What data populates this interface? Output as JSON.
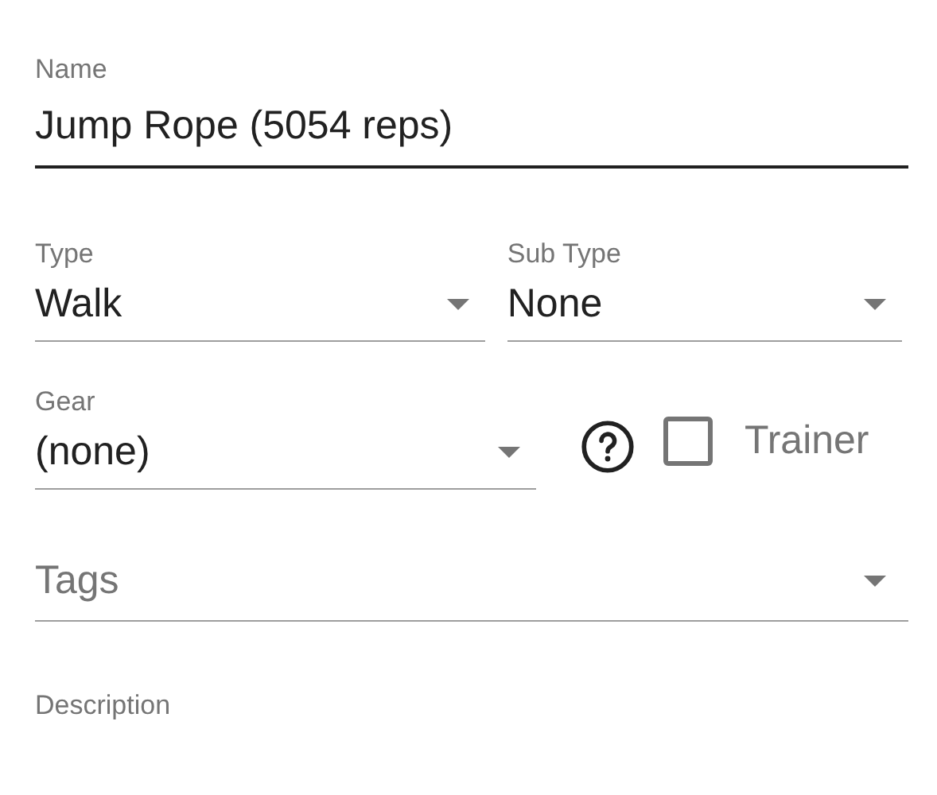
{
  "name_field": {
    "label": "Name",
    "value": "Jump Rope (5054 reps)"
  },
  "type_field": {
    "label": "Type",
    "value": "Walk"
  },
  "sub_type_field": {
    "label": "Sub Type",
    "value": "None"
  },
  "gear_field": {
    "label": "Gear",
    "value": "(none)"
  },
  "trainer": {
    "label": "Trainer",
    "checked": false
  },
  "tags_field": {
    "placeholder": "Tags"
  },
  "description_field": {
    "label": "Description"
  }
}
